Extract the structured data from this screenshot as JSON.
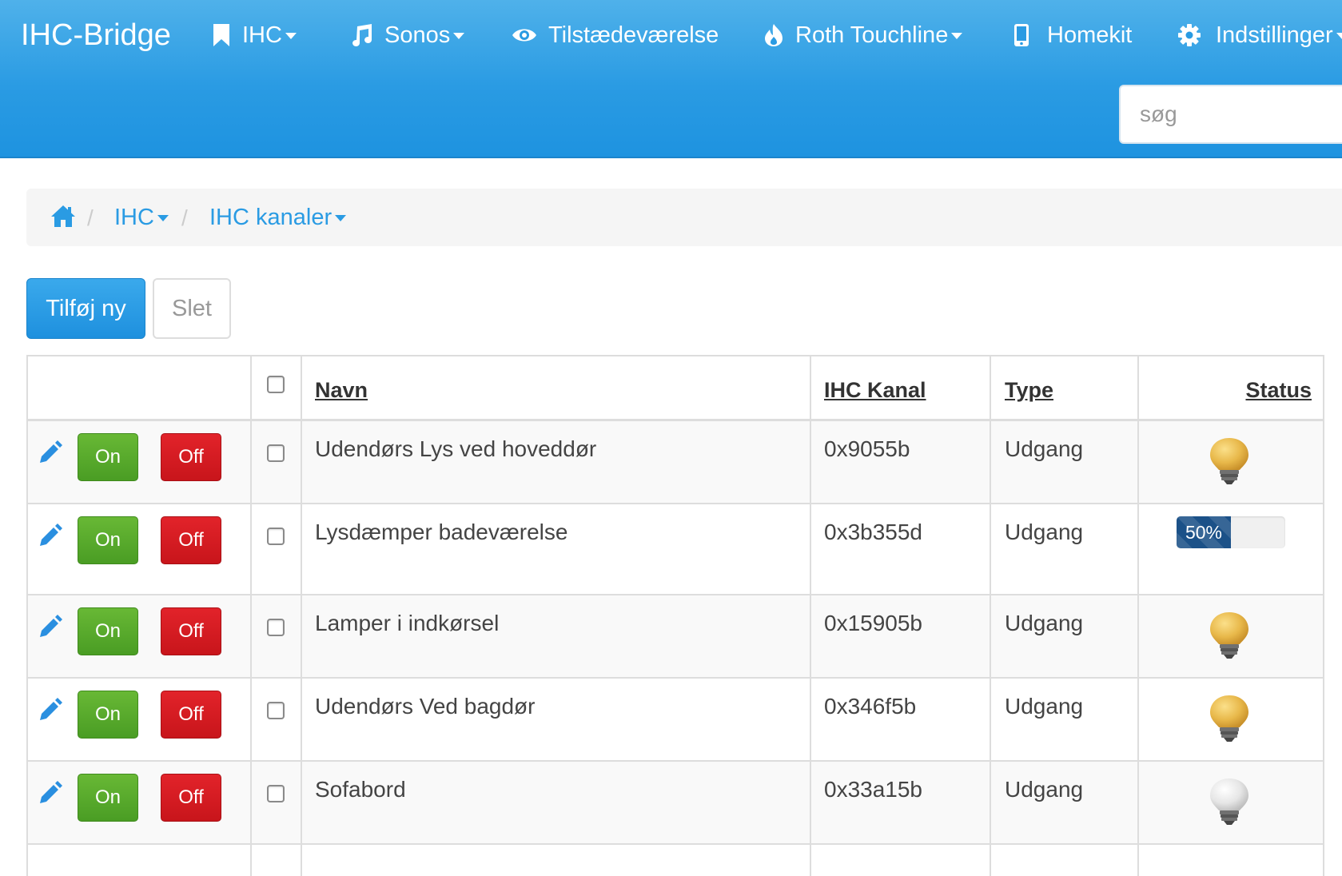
{
  "navbar": {
    "brand": "IHC-Bridge",
    "items": [
      {
        "label": "IHC",
        "icon": "bookmark-icon",
        "dropdown": true
      },
      {
        "label": "Sonos",
        "icon": "music-note-icon",
        "dropdown": true
      },
      {
        "label": "Tilstædeværelse",
        "icon": "eye-icon",
        "dropdown": false
      },
      {
        "label": "Roth Touchline",
        "icon": "fire-icon",
        "dropdown": true
      },
      {
        "label": "Homekit",
        "icon": "phone-icon",
        "dropdown": false
      },
      {
        "label": "Indstillinger",
        "icon": "gear-icon",
        "dropdown": true
      }
    ],
    "search_placeholder": "søg"
  },
  "breadcrumb": {
    "home_icon": "home-icon",
    "items": [
      {
        "label": "IHC",
        "dropdown": true
      },
      {
        "label": "IHC kanaler",
        "dropdown": true
      }
    ]
  },
  "actions": {
    "add_label": "Tilføj ny",
    "delete_label": "Slet"
  },
  "table": {
    "headers": {
      "name": "Navn",
      "channel": "IHC Kanal",
      "type": "Type",
      "status": "Status"
    },
    "on_label": "On",
    "off_label": "Off",
    "rows": [
      {
        "name": "Udendørs Lys ved hoveddør",
        "channel": "0x9055b",
        "type": "Udgang",
        "status_kind": "bulb-on"
      },
      {
        "name": "Lysdæmper badeværelse",
        "channel": "0x3b355d",
        "type": "Udgang",
        "status_kind": "dimmer",
        "dimmer_value": 50,
        "dimmer_label": "50%"
      },
      {
        "name": "Lamper i indkørsel",
        "channel": "0x15905b",
        "type": "Udgang",
        "status_kind": "bulb-on"
      },
      {
        "name": "Udendørs Ved bagdør",
        "channel": "0x346f5b",
        "type": "Udgang",
        "status_kind": "bulb-on"
      },
      {
        "name": "Sofabord",
        "channel": "0x33a15b",
        "type": "Udgang",
        "status_kind": "bulb-off"
      }
    ]
  },
  "colors": {
    "navbar": "#2a9be3",
    "on_button": "#5aab2c",
    "off_button": "#d51c22",
    "bulb_on": "#e8b84a",
    "bulb_off": "#e6e6e6",
    "progress": "#1b5188",
    "link": "#2a9be3"
  }
}
